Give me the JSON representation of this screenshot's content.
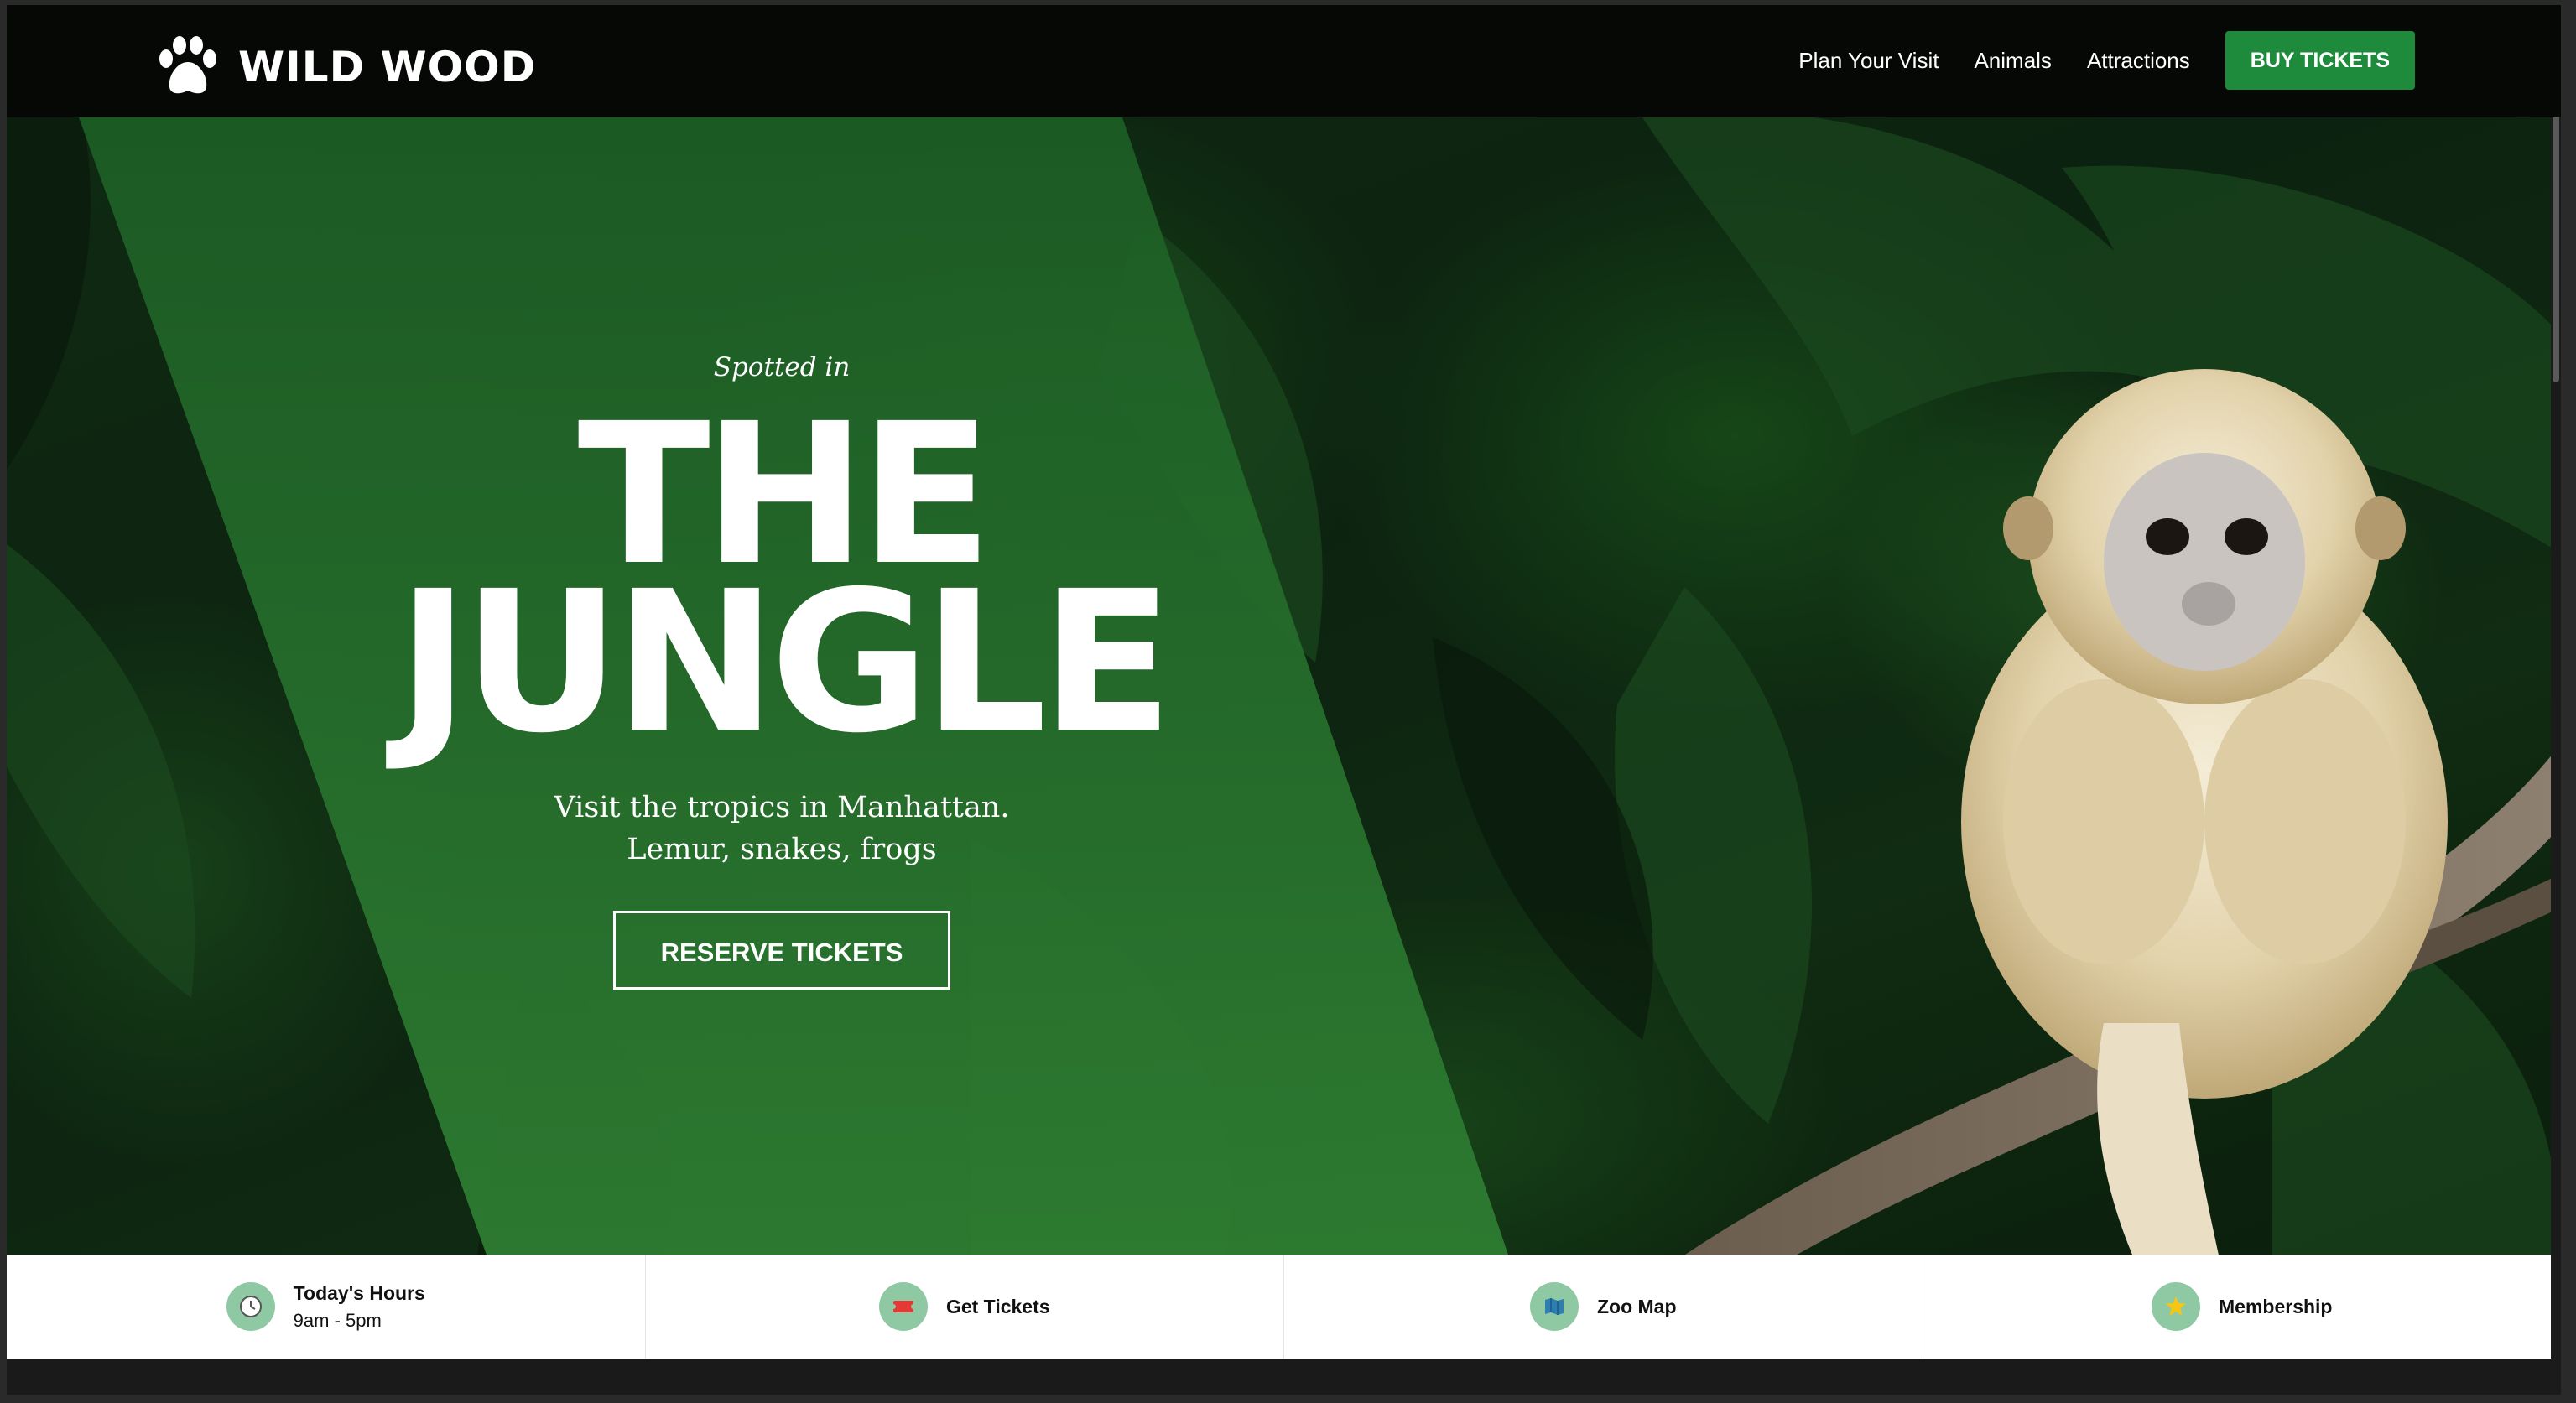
{
  "brand": {
    "name": "WILD WOOD",
    "logo_icon": "paw-icon"
  },
  "nav": {
    "links": [
      "Plan Your Visit",
      "Animals",
      "Attractions"
    ],
    "cta_label": "BUY TICKETS"
  },
  "hero": {
    "eyebrow": "Spotted in",
    "headline_line1": "THE",
    "headline_line2": "JUNGLE",
    "subtext_line1": "Visit the tropics in Manhattan.",
    "subtext_line2": "Lemur, snakes, frogs",
    "cta_label": "RESERVE TICKETS"
  },
  "infobar": {
    "items": [
      {
        "title": "Today's Hours",
        "subtitle": "9am - 5pm",
        "icon": "clock-icon"
      },
      {
        "title": "Get Tickets",
        "icon": "ticket-icon"
      },
      {
        "title": "Zoo Map",
        "icon": "map-icon"
      },
      {
        "title": "Membership",
        "icon": "star-icon"
      }
    ]
  },
  "colors": {
    "accent": "#1e8a3c",
    "panel_green": "#1f6b2a",
    "icon_bg": "#8fc9a4"
  }
}
